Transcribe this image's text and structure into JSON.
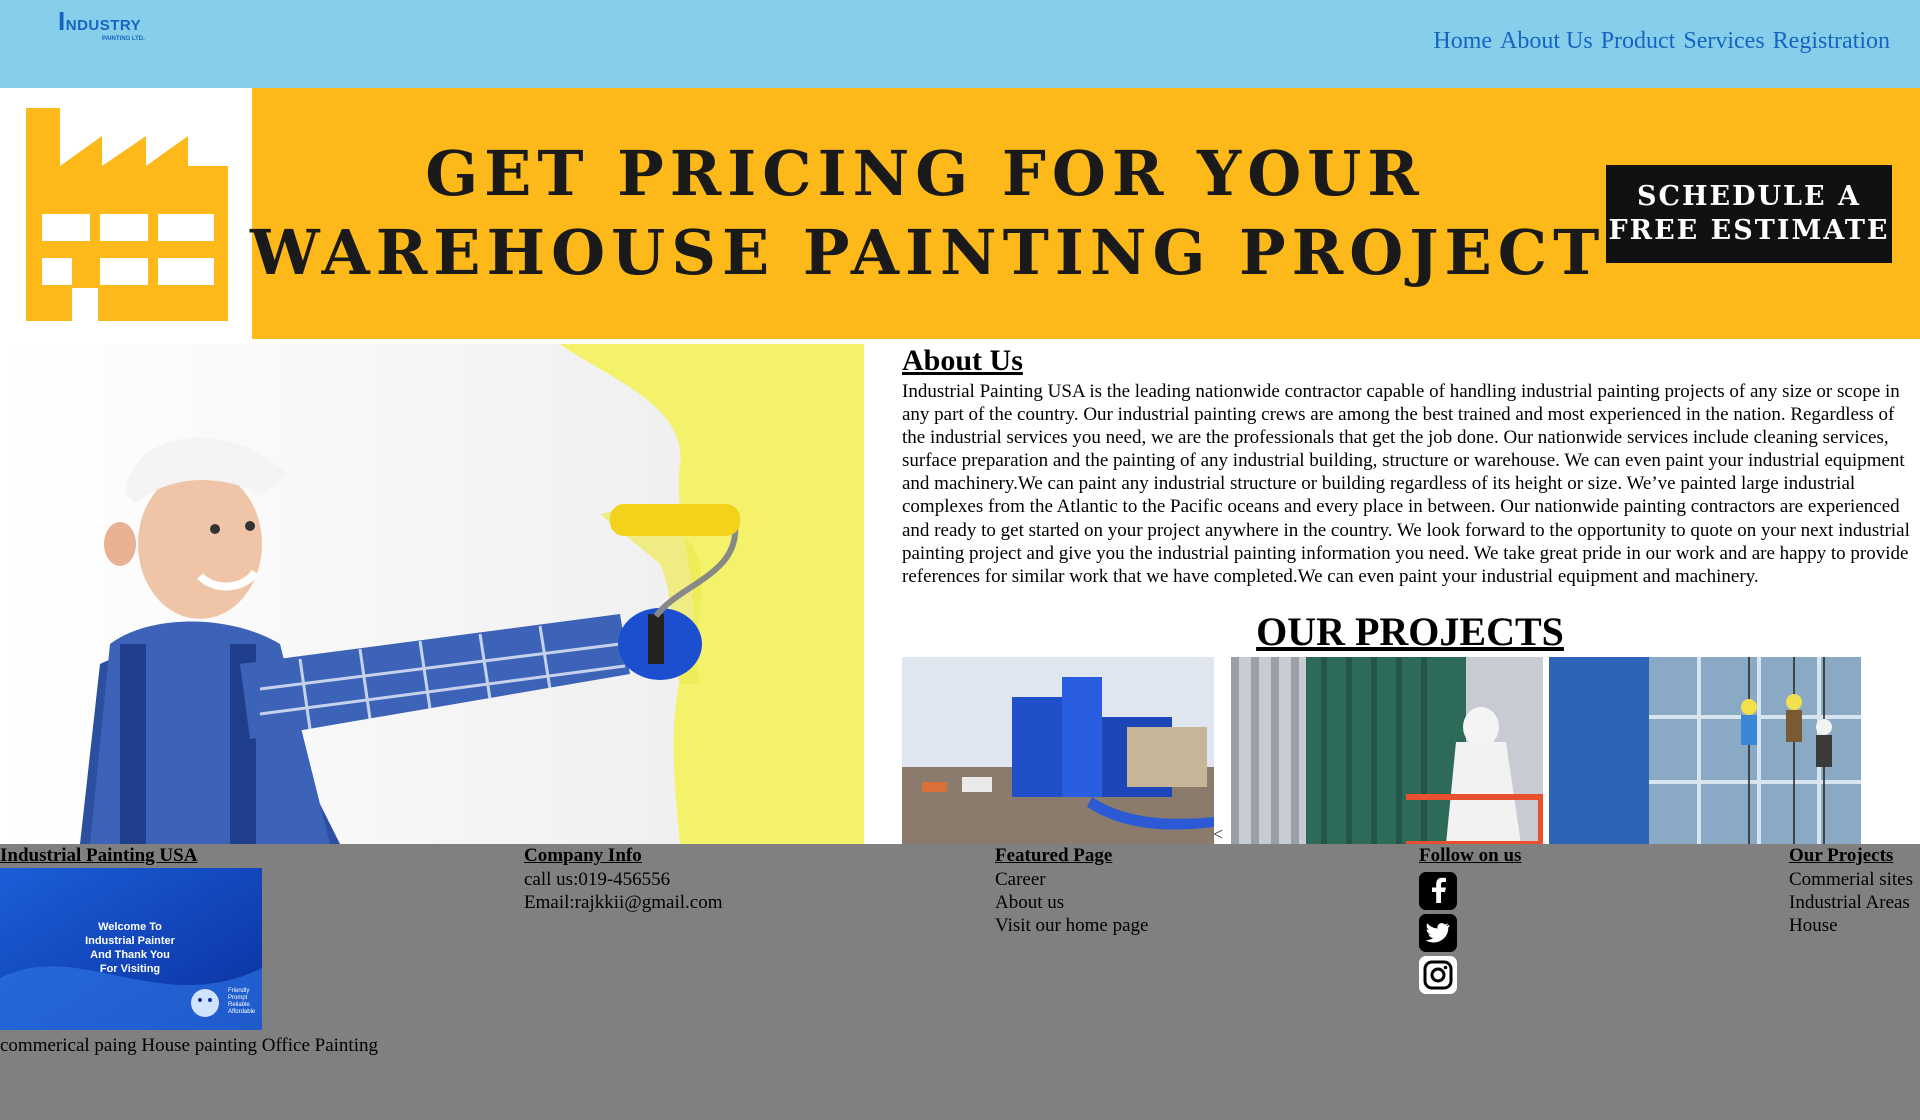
{
  "header": {
    "logo_text_big": "I",
    "logo_text_rest": "NDUSTRY",
    "logo_sub": "PAINTING LTD.",
    "nav": [
      "Home",
      "About Us",
      "Product",
      "Services",
      "Registration"
    ]
  },
  "banner": {
    "line1": "GET PRICING FOR YOUR",
    "line2": "WAREHOUSE PAINTING PROJECT",
    "cta_line1": "SCHEDULE A",
    "cta_line2": "FREE ESTIMATE",
    "colors": {
      "background": "#fcb919",
      "cta": "#111111"
    }
  },
  "about": {
    "title": "About Us",
    "text": "Industrial Painting USA is the leading nationwide contractor capable of handling industrial painting projects of any size or scope in any part of the country. Our industrial painting crews are among the best trained and most experienced in the nation. Regardless of the industrial services you need, we are the professionals that get the job done. Our nationwide services include cleaning services, surface preparation and the painting of any industrial building, structure or warehouse. We can even paint your industrial equipment and machinery.We can paint any industrial structure or building regardless of its height or size. We’ve painted large industrial complexes from the Atlantic to the Pacific oceans and every place in between. Our nationwide painting contractors are experienced and ready to get started on your project anywhere in the country. We look forward to the opportunity to quote on your next industrial painting project and give you the industrial painting information you need. We take great pride in our work and are happy to provide references for similar work that we have completed.We can even paint your industrial equipment and machinery."
  },
  "projects": {
    "title": "OUR PROJECTS",
    "stray_char": "<"
  },
  "footer": {
    "col1": {
      "heading": "Industrial Painting USA",
      "welcome_lines": [
        "Welcome To",
        "Industrial Painter",
        "And Thank You",
        "For Visiting"
      ],
      "welcome_tags": [
        "Friendly",
        "Prompt",
        "Reliable",
        "Affordable"
      ],
      "links": [
        "commerical paing",
        "House painting",
        "Office Painting"
      ]
    },
    "col2": {
      "heading": "Company Info",
      "phone": "call us:019-456556",
      "email": "Email:rajkkii@gmail.com"
    },
    "col3": {
      "heading": "Featured Page",
      "links": [
        "Career",
        "About us",
        "Visit our home page"
      ]
    },
    "col4": {
      "heading": "Follow on us",
      "icons": [
        "facebook-icon",
        "twitter-icon",
        "instagram-icon"
      ]
    },
    "col5": {
      "heading": "Our Projects",
      "links": [
        "Commerial sites",
        "Industrial Areas",
        "House"
      ]
    }
  }
}
